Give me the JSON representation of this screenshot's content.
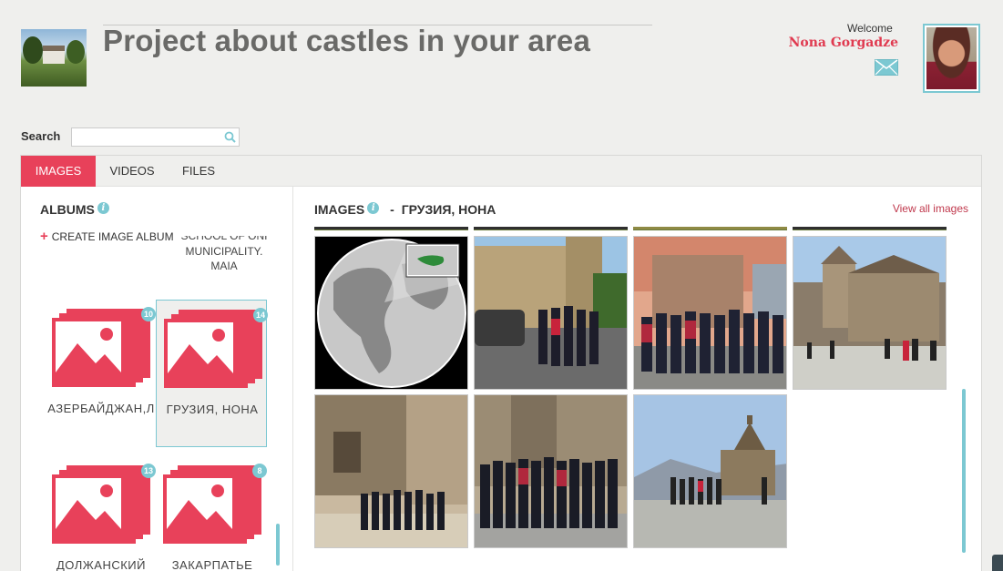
{
  "header": {
    "title": "Project about castles in your area",
    "welcome_label": "Welcome",
    "user_name": "Nona Gorgadze"
  },
  "search": {
    "label": "Search",
    "value": "",
    "placeholder": ""
  },
  "tabs": [
    {
      "label": "IMAGES",
      "active": true
    },
    {
      "label": "VIDEOS",
      "active": false
    },
    {
      "label": "FILES",
      "active": false
    }
  ],
  "albums": {
    "title": "ALBUMS",
    "create_label": "CREATE IMAGE ALBUM",
    "clipped_album_lines": [
      "SCHOOL OF ONI",
      "MUNICIPALITY.",
      "MAIA"
    ],
    "items": [
      {
        "name": "АЗЕРБАЙДЖАН,Л",
        "count": "10",
        "selected": false
      },
      {
        "name": "ГРУЗИЯ, НОНА",
        "count": "14",
        "selected": true
      },
      {
        "name": "ДОЛЖАНСКИЙ",
        "count": "13",
        "selected": false
      },
      {
        "name": "ЗАКАРПАТЬЕ",
        "count": "8",
        "selected": false
      }
    ]
  },
  "images_panel": {
    "title": "IMAGES",
    "separator": "-",
    "album_name": "ГРУЗИЯ, НОНА",
    "view_all_label": "View all images",
    "images": [
      {
        "subject": "globe-map"
      },
      {
        "subject": "castle-wall-group"
      },
      {
        "subject": "students-group"
      },
      {
        "subject": "church-bell-tower"
      },
      {
        "subject": "church-group"
      },
      {
        "subject": "students-row"
      },
      {
        "subject": "chapel-hill"
      }
    ]
  },
  "colors": {
    "accent": "#e8415a",
    "teal": "#7cc8d2",
    "background": "#efefed",
    "name_red": "#e03a50"
  }
}
